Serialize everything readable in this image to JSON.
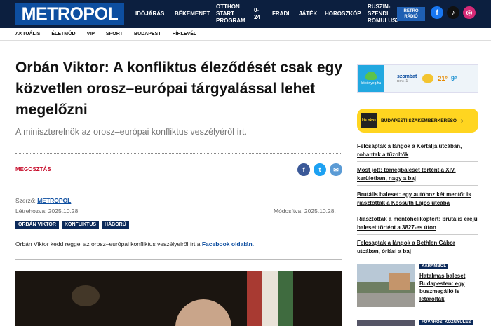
{
  "header": {
    "logo": "METROPOL",
    "nav": [
      "IDŐJÁRÁS",
      "BÉKEMENET",
      "OTTHON START PROGRAM",
      "0-24",
      "FRADI",
      "JÁTÉK",
      "HOROSZKÓP",
      "RUSZIN-SZENDI ROMULUSZ"
    ],
    "retro": "RETRO RÁDIÓ",
    "socials": [
      {
        "icon": "facebook-icon",
        "glyph": "f",
        "color": "#1877f2"
      },
      {
        "icon": "tiktok-icon",
        "glyph": "♪",
        "color": "#111111"
      },
      {
        "icon": "instagram-icon",
        "glyph": "◎",
        "color": "#d62976"
      }
    ]
  },
  "subnav": [
    "AKTUÁLIS",
    "ÉLETMÓD",
    "VIP",
    "SPORT",
    "BUDAPEST",
    "HÍRLEVÉL"
  ],
  "article": {
    "title": "Orbán Viktor: A konfliktus éleződését csak egy közvetlen orosz–európai tárgyalással lehet megelőzni",
    "lead": "A miniszterelnök az orosz–európai konfliktus veszélyéről írt.",
    "share_label": "MEGOSZTÁS",
    "author_label": "Szerző:",
    "author": "METROPOL",
    "created": "Létrehozva: 2025.10.28.",
    "modified": "Módosítva: 2025.10.28.",
    "tags": [
      "ORBÁN VIKTOR",
      "KONFLIKTUS",
      "HÁBORÚ"
    ],
    "body_text": "Orbán Viktor kedd reggel az orosz–európai konfliktus veszélyeiről írt a ",
    "body_link": "Facebook oldalán.",
    "share_icons": [
      {
        "icon": "facebook-share-icon",
        "glyph": "f",
        "color": "#3b5998"
      },
      {
        "icon": "twitter-share-icon",
        "glyph": "t",
        "color": "#1da1f2"
      },
      {
        "icon": "email-share-icon",
        "glyph": "✉",
        "color": "#5b9bd5"
      }
    ]
  },
  "sidebar": {
    "weather": {
      "brand": "köpönyeg.hu",
      "day": "szombat",
      "date": "nov. 1",
      "max": "21°",
      "min": "9°"
    },
    "kisokos": {
      "logo": "kis okos",
      "text": "BUDAPESTI SZAKEMBERKERESŐ",
      "chevron": "›"
    },
    "news": [
      "Felcsaptak a lángok a Kertalja utcában, rohantak a tűzoltók",
      "Most jött: tömegbaleset történt a XIV. kerületben, nagy a baj",
      "Brutális baleset: egy autóhoz két mentőt is riasztottak a Kossuth Lajos utcába",
      "Riasztották a mentőhelikoptert: brutális erejű baleset történt a 3827-es úton",
      "Felcsaptak a lángok a Bethlen Gábor utcában, óriási a baj"
    ],
    "card": {
      "badge": "KARAMBOL",
      "title": "Hatalmas baleset Budapesten: egy buszmegálló is letarolták"
    },
    "card2_badge": "FŐVÁROSI KÖZGYŰLÉS"
  }
}
